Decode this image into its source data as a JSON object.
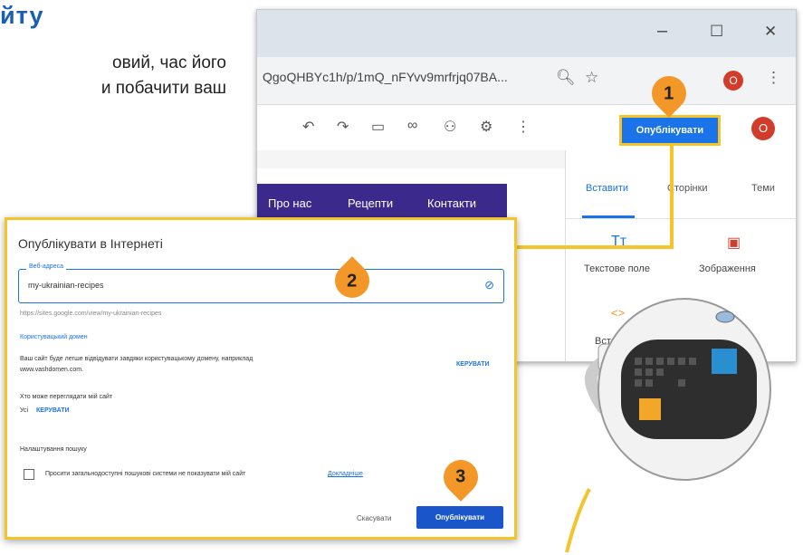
{
  "page": {
    "heading": "йту",
    "intro_lines": [
      "овий, час його",
      "и побачити ваш"
    ]
  },
  "browser": {
    "window_controls": [
      "–",
      "☐",
      "✕"
    ],
    "url": "QgoQHBYc1h/p/1mQ_nFYvv9mrfrjq07BA...",
    "profile_initial": "O",
    "publish_button": "Опублікувати",
    "nav_items": [
      "Про нас",
      "Рецепти",
      "Контакти"
    ],
    "side_tabs": [
      "Вставити",
      "Сторінки",
      "Теми"
    ],
    "side_items": [
      {
        "icon": "Tт",
        "label": "Текстове поле"
      },
      {
        "icon": "▣",
        "label": "Зображення"
      },
      {
        "icon": "<>",
        "label": "Встав"
      }
    ]
  },
  "dialog": {
    "title": "Опублікувати в Інтернеті",
    "field_label": "Веб-адреса",
    "field_value": "my-ukrainian-recipes",
    "url_hint": "https://sites.google.com/view/my-ukrainian-recipes",
    "custom_domain_title": "Користувацький домен",
    "custom_domain_text": "Ваш сайт буде легше відвідувати завдяки користувацькому домену, наприклад",
    "custom_domain_example": "www.vashdomen.com.",
    "manage_label": "КЕРУВАТИ",
    "who_can_view_title": "Хто може переглядати мій сайт",
    "who_can_view_value": "Усі",
    "search_settings_title": "Налаштування пошуку",
    "search_checkbox_text": "Просити загальнодоступні пошукові системи не показувати мій сайт",
    "learn_more": "Докладніше",
    "cancel_label": "Скасувати",
    "publish_label": "Опублікувати"
  },
  "callouts": [
    "1",
    "2",
    "3"
  ],
  "colors": {
    "heading": "#1a5fb4",
    "highlight": "#f4c42a",
    "callout": "#f29728",
    "primary": "#1a73e8",
    "nav_bg": "#3b2a8c"
  }
}
